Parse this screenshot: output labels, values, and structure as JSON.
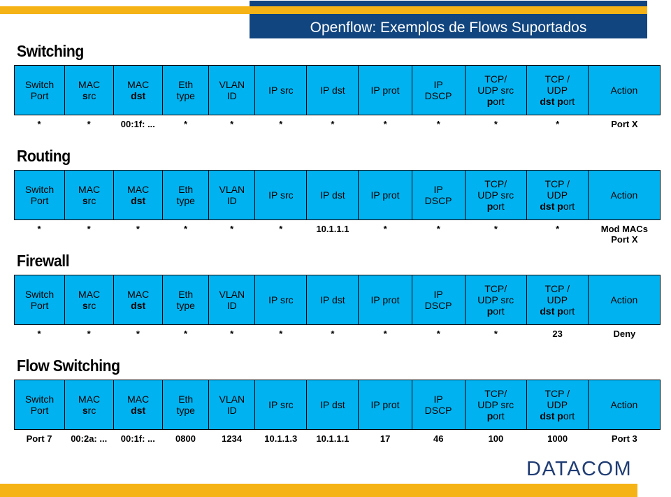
{
  "banner": {
    "title": "Openflow: Exemplos de Flows Suportados",
    "bar_color": "#f5b316",
    "banner_color": "#11457f"
  },
  "logo": {
    "text": "DATACOM",
    "color": "#1f3c73",
    "bar_color": "#f5b316"
  },
  "theme": {
    "cell_fill": "#00b3f0",
    "cell_border": "#000000",
    "text": "#000000"
  },
  "columns": [
    {
      "line1": "Switch",
      "line2": "Port",
      "bold1": false,
      "bold2": false
    },
    {
      "line1": "MAC",
      "line2": "src",
      "bold1": false,
      "bold2": "partial-s"
    },
    {
      "line1": "MAC",
      "line2": "dst",
      "bold1": false,
      "bold2": true
    },
    {
      "line1": "Eth",
      "line2": "type",
      "bold1": false,
      "bold2": false
    },
    {
      "line1": "VLAN",
      "line2": "ID",
      "bold1": false,
      "bold2": false
    },
    {
      "line1": "IP src",
      "line2": "",
      "bold1": false,
      "bold2": false
    },
    {
      "line1": "IP dst",
      "line2": "",
      "bold1": false,
      "bold2": false
    },
    {
      "line1": "IP prot",
      "line2": "",
      "bold1": false,
      "bold2": false
    },
    {
      "line1": "IP",
      "line2": "DSCP",
      "bold1": false,
      "bold2": false
    },
    {
      "line1": "TCP/",
      "line2": "UDP src",
      "line3": "port",
      "bold1": false,
      "bold2": false
    },
    {
      "line1": "TCP /",
      "line2": "UDP",
      "line3": "dst port",
      "bold1": false,
      "bold2": false
    },
    {
      "line1": "Action",
      "line2": "",
      "bold1": false,
      "bold2": false
    }
  ],
  "sections": [
    {
      "title": "Switching",
      "values": [
        "*",
        "*",
        "00:1f: ...",
        "*",
        "*",
        "*",
        "*",
        "*",
        "*",
        "*",
        "*"
      ],
      "action": "Port X",
      "action_line2": ""
    },
    {
      "title": "Routing",
      "values": [
        "*",
        "*",
        "*",
        "*",
        "*",
        "*",
        "10.1.1.1",
        "*",
        "*",
        "*",
        "*"
      ],
      "action": "Mod MACs",
      "action_line2": "Port  X"
    },
    {
      "title": "Firewall",
      "values": [
        "*",
        "*",
        "*",
        "*",
        "*",
        "*",
        "*",
        "*",
        "*",
        "*",
        "23"
      ],
      "action": "Deny",
      "action_line2": ""
    },
    {
      "title": "Flow Switching",
      "values": [
        "Port 7",
        "00:2a: ...",
        "00:1f: ...",
        "0800",
        "1234",
        "10.1.1.3",
        "10.1.1.1",
        "17",
        "46",
        "100",
        "1000"
      ],
      "action": "Port 3",
      "action_line2": ""
    }
  ]
}
